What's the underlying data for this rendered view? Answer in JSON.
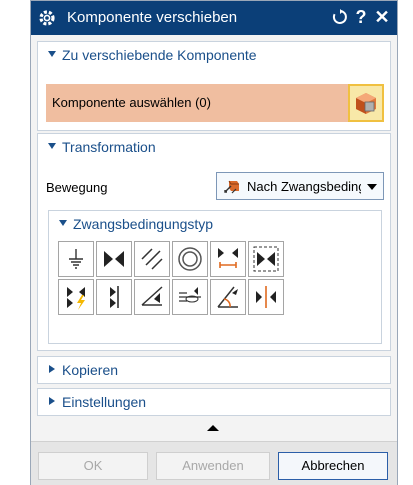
{
  "window": {
    "title": "Komponente verschieben",
    "controls": {
      "reset_icon": "reset-icon",
      "help_label": "?",
      "close_label": "✕"
    }
  },
  "sections": {
    "komponente": {
      "label": "Zu verschiebende Komponente",
      "select_label": "Komponente auswählen (0)"
    },
    "transformation": {
      "label": "Transformation",
      "bewegung_label": "Bewegung",
      "bewegung_value": "Nach Zwangsbedingungen",
      "constraint_type_label": "Zwangsbedingungstyp",
      "constraint_tools": [
        "touch-align-icon",
        "concentric-icon",
        "distance-icon",
        "fix-icon",
        "parallel-icon",
        "perpendicular-icon",
        "fit-icon",
        "bond-icon",
        "center-icon",
        "angle-icon",
        "align-lock-icon",
        "symmetric-icon"
      ]
    },
    "kopieren": {
      "label": "Kopieren"
    },
    "einstellungen": {
      "label": "Einstellungen"
    }
  },
  "footer": {
    "ok_label": "OK",
    "apply_label": "Anwenden",
    "cancel_label": "Abbrechen"
  },
  "colors": {
    "titlebar": "#0b3f78",
    "section_text": "#1a4f8a",
    "selection_highlight": "#f0bea0",
    "accent_yellow": "#f0c040"
  }
}
